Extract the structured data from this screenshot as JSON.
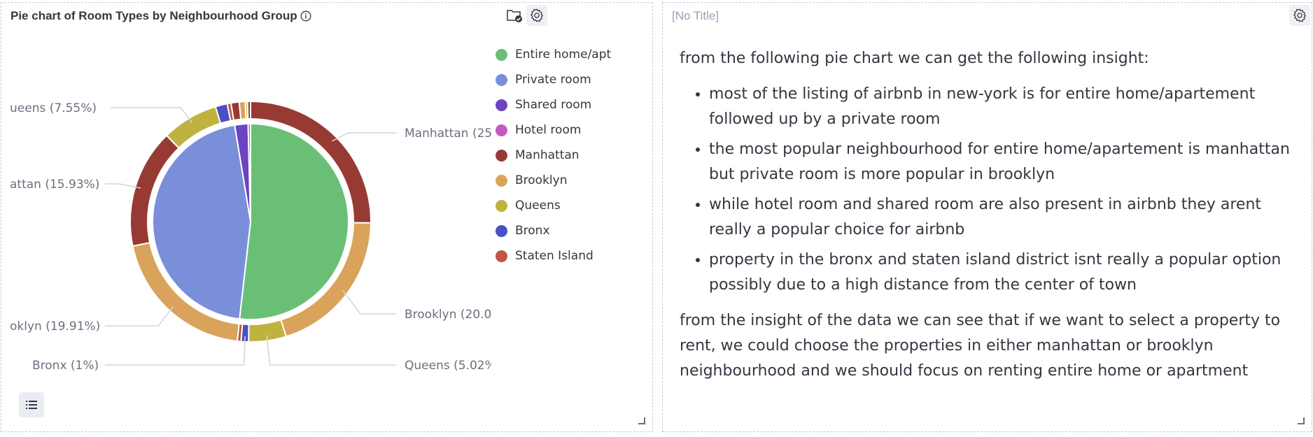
{
  "left_panel": {
    "title": "Pie chart of Room Types by Neighbourhood Group",
    "icons": [
      "info-icon",
      "folder-check-icon",
      "gear-icon",
      "list-icon",
      "resize-icon"
    ]
  },
  "right_panel": {
    "title": "[No Title]",
    "intro": "from the following pie chart we can get the following insight:",
    "bullets": [
      "most of the listing of airbnb in new-york is for entire home/apartement followed up by a private room",
      "the most popular neighbourhood for entire home/apartement is manhattan but private room is more popular in brooklyn",
      "while hotel room and shared room are also present in airbnb they arent really a popular choice for airbnb",
      "property in the bronx and staten island district isnt really a popular option possibly due to a high distance from the center of town"
    ],
    "conclusion": "from the insight of the data we can see that if we want to select a property to rent, we could choose the properties in either manhattan or brooklyn neighbourhood and we should focus on renting entire home or apartment"
  },
  "chart_data": {
    "type": "pie",
    "title": "Pie chart of Room Types by Neighbourhood Group",
    "legend": {
      "position": "right",
      "items": [
        {
          "name": "Entire home/apt",
          "color": "#6abf77"
        },
        {
          "name": "Private room",
          "color": "#7a8ed9"
        },
        {
          "name": "Shared room",
          "color": "#6b44c1"
        },
        {
          "name": "Hotel room",
          "color": "#c05bc1"
        },
        {
          "name": "Manhattan",
          "color": "#983a34"
        },
        {
          "name": "Brooklyn",
          "color": "#d9a35c"
        },
        {
          "name": "Queens",
          "color": "#bfb23f"
        },
        {
          "name": "Bronx",
          "color": "#4a51c4"
        },
        {
          "name": "Staten Island",
          "color": "#bf5643"
        }
      ]
    },
    "inner_ring": [
      {
        "name": "Entire home/apt",
        "value": 51.8,
        "color": "#6abf77"
      },
      {
        "name": "Private room",
        "value": 45.6,
        "color": "#7a8ed9"
      },
      {
        "name": "Shared room",
        "value": 2.2,
        "color": "#6b44c1"
      },
      {
        "name": "Hotel room",
        "value": 0.4,
        "color": "#c05bc1"
      }
    ],
    "outer_ring": [
      {
        "group": "Entire home/apt",
        "name": "Manhattan",
        "value": 25.1,
        "color": "#983a34"
      },
      {
        "group": "Entire home/apt",
        "name": "Brooklyn",
        "value": 20.0,
        "color": "#d9a35c"
      },
      {
        "group": "Entire home/apt",
        "name": "Queens",
        "value": 5.02,
        "color": "#bfb23f"
      },
      {
        "group": "Entire home/apt",
        "name": "Bronx",
        "value": 1.0,
        "color": "#4a51c4"
      },
      {
        "group": "Entire home/apt",
        "name": "Staten Island",
        "value": 0.5,
        "color": "#bf5643"
      },
      {
        "group": "Private room",
        "name": "Brooklyn",
        "value": 19.91,
        "color": "#d9a35c"
      },
      {
        "group": "Private room",
        "name": "Manhattan",
        "value": 15.93,
        "color": "#983a34"
      },
      {
        "group": "Private room",
        "name": "Queens",
        "value": 7.55,
        "color": "#bfb23f"
      },
      {
        "group": "Private room",
        "name": "Bronx",
        "value": 1.6,
        "color": "#4a51c4"
      },
      {
        "group": "Private room",
        "name": "Staten Island",
        "value": 0.5,
        "color": "#bf5643"
      },
      {
        "group": "Shared room",
        "name": "Manhattan",
        "value": 1.1,
        "color": "#983a34"
      },
      {
        "group": "Shared room",
        "name": "Brooklyn",
        "value": 0.8,
        "color": "#d9a35c"
      },
      {
        "group": "Shared room",
        "name": "Queens",
        "value": 0.3,
        "color": "#bfb23f"
      },
      {
        "group": "Hotel room",
        "name": "Manhattan",
        "value": 0.4,
        "color": "#983a34"
      }
    ],
    "callouts": [
      {
        "text": "ueens (7.55%)"
      },
      {
        "text": "attan (15.93%)"
      },
      {
        "text": "oklyn (19.91%)"
      },
      {
        "text": "Bronx (1%)"
      },
      {
        "text": "Manhattan (25"
      },
      {
        "text": "Brooklyn (20.0"
      },
      {
        "text": "Queens (5.02%"
      }
    ]
  }
}
